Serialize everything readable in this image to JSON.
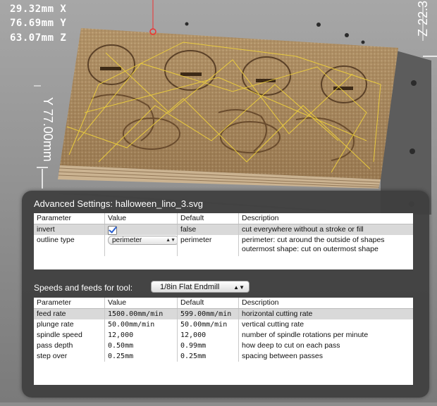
{
  "viewport": {
    "readout": {
      "x": "29.32mm X",
      "y": "76.69mm Y",
      "z": "63.07mm Z"
    },
    "dims": {
      "y": "Y 77.00mm",
      "z": "Z 22.3"
    }
  },
  "advanced": {
    "title": "Advanced Settings: halloween_lino_3.svg",
    "columns": [
      "Parameter",
      "Value",
      "Default",
      "Description"
    ],
    "rows": [
      {
        "param": "invert",
        "value_checked": true,
        "default": "false",
        "desc": "cut everywhere without a stroke or fill"
      },
      {
        "param": "outline type",
        "value": "perimeter",
        "default": "perimeter",
        "desc1": "perimeter: cut around the outside of shapes",
        "desc2": "outermost shape: cut on outermost shape"
      }
    ]
  },
  "speeds": {
    "label": "Speeds and feeds for tool:",
    "tool": "1/8in Flat Endmill",
    "columns": [
      "Parameter",
      "Value",
      "Default",
      "Description"
    ],
    "rows": [
      {
        "param": "feed rate",
        "value": "1500.00mm/min",
        "default": "599.00mm/min",
        "desc": "horizontal cutting rate"
      },
      {
        "param": "plunge rate",
        "value": "50.00mm/min",
        "default": "50.00mm/min",
        "desc": "vertical cutting rate"
      },
      {
        "param": "spindle speed",
        "value": "12,000",
        "default": "12,000",
        "desc": "number of spindle rotations per minute"
      },
      {
        "param": "pass depth",
        "value": "0.50mm",
        "default": "0.99mm",
        "desc": "how deep to cut on each pass"
      },
      {
        "param": "step over",
        "value": "0.25mm",
        "default": "0.25mm",
        "desc": "spacing between passes"
      }
    ]
  }
}
